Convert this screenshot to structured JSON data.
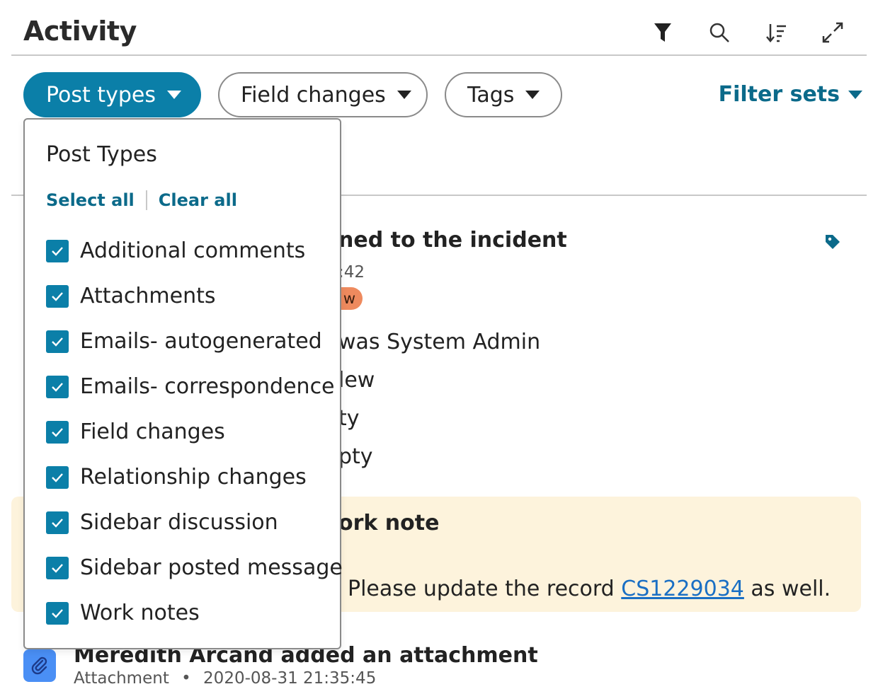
{
  "header": {
    "title": "Activity",
    "icons": [
      "filter-icon",
      "search-icon",
      "sort-icon",
      "expand-icon"
    ]
  },
  "filters": {
    "post_types": "Post types",
    "field_changes": "Field changes",
    "tags": "Tags",
    "filter_sets": "Filter sets"
  },
  "dropdown": {
    "title": "Post Types",
    "select_all": "Select all",
    "clear_all": "Clear all",
    "options": [
      {
        "label": "Additional comments",
        "checked": true
      },
      {
        "label": "Attachments",
        "checked": true
      },
      {
        "label": "Emails- autogenerated",
        "checked": true
      },
      {
        "label": "Emails- correspondence",
        "checked": true
      },
      {
        "label": "Field changes",
        "checked": true
      },
      {
        "label": "Relationship changes",
        "checked": true
      },
      {
        "label": "Sidebar discussion",
        "checked": true
      },
      {
        "label": "Sidebar posted message",
        "checked": true
      },
      {
        "label": "Work notes",
        "checked": true
      }
    ]
  },
  "feed": {
    "entry1": {
      "title_fragment": "ned to the incident",
      "time_fragment": ":42",
      "badge_fragment": "w",
      "line1": "was System Admin",
      "line2": "lew",
      "line3": "ty",
      "line4": "pty"
    },
    "worknote": {
      "title_fragment": "ork note",
      "text_before": "Please update the record ",
      "link": "CS1229034",
      "text_after": " as well."
    },
    "entry3": {
      "title": "Meredith Arcand added an attachment",
      "type": "Attachment",
      "dot": "•",
      "time": "2020-08-31 21:35:45"
    }
  },
  "colors": {
    "accent": "#0b7fa8",
    "link": "#1a6fc4",
    "badge": "#ee8a5e",
    "worknote_bg": "#fdf3dc",
    "attachment_icon_bg": "#4a8ff5"
  }
}
